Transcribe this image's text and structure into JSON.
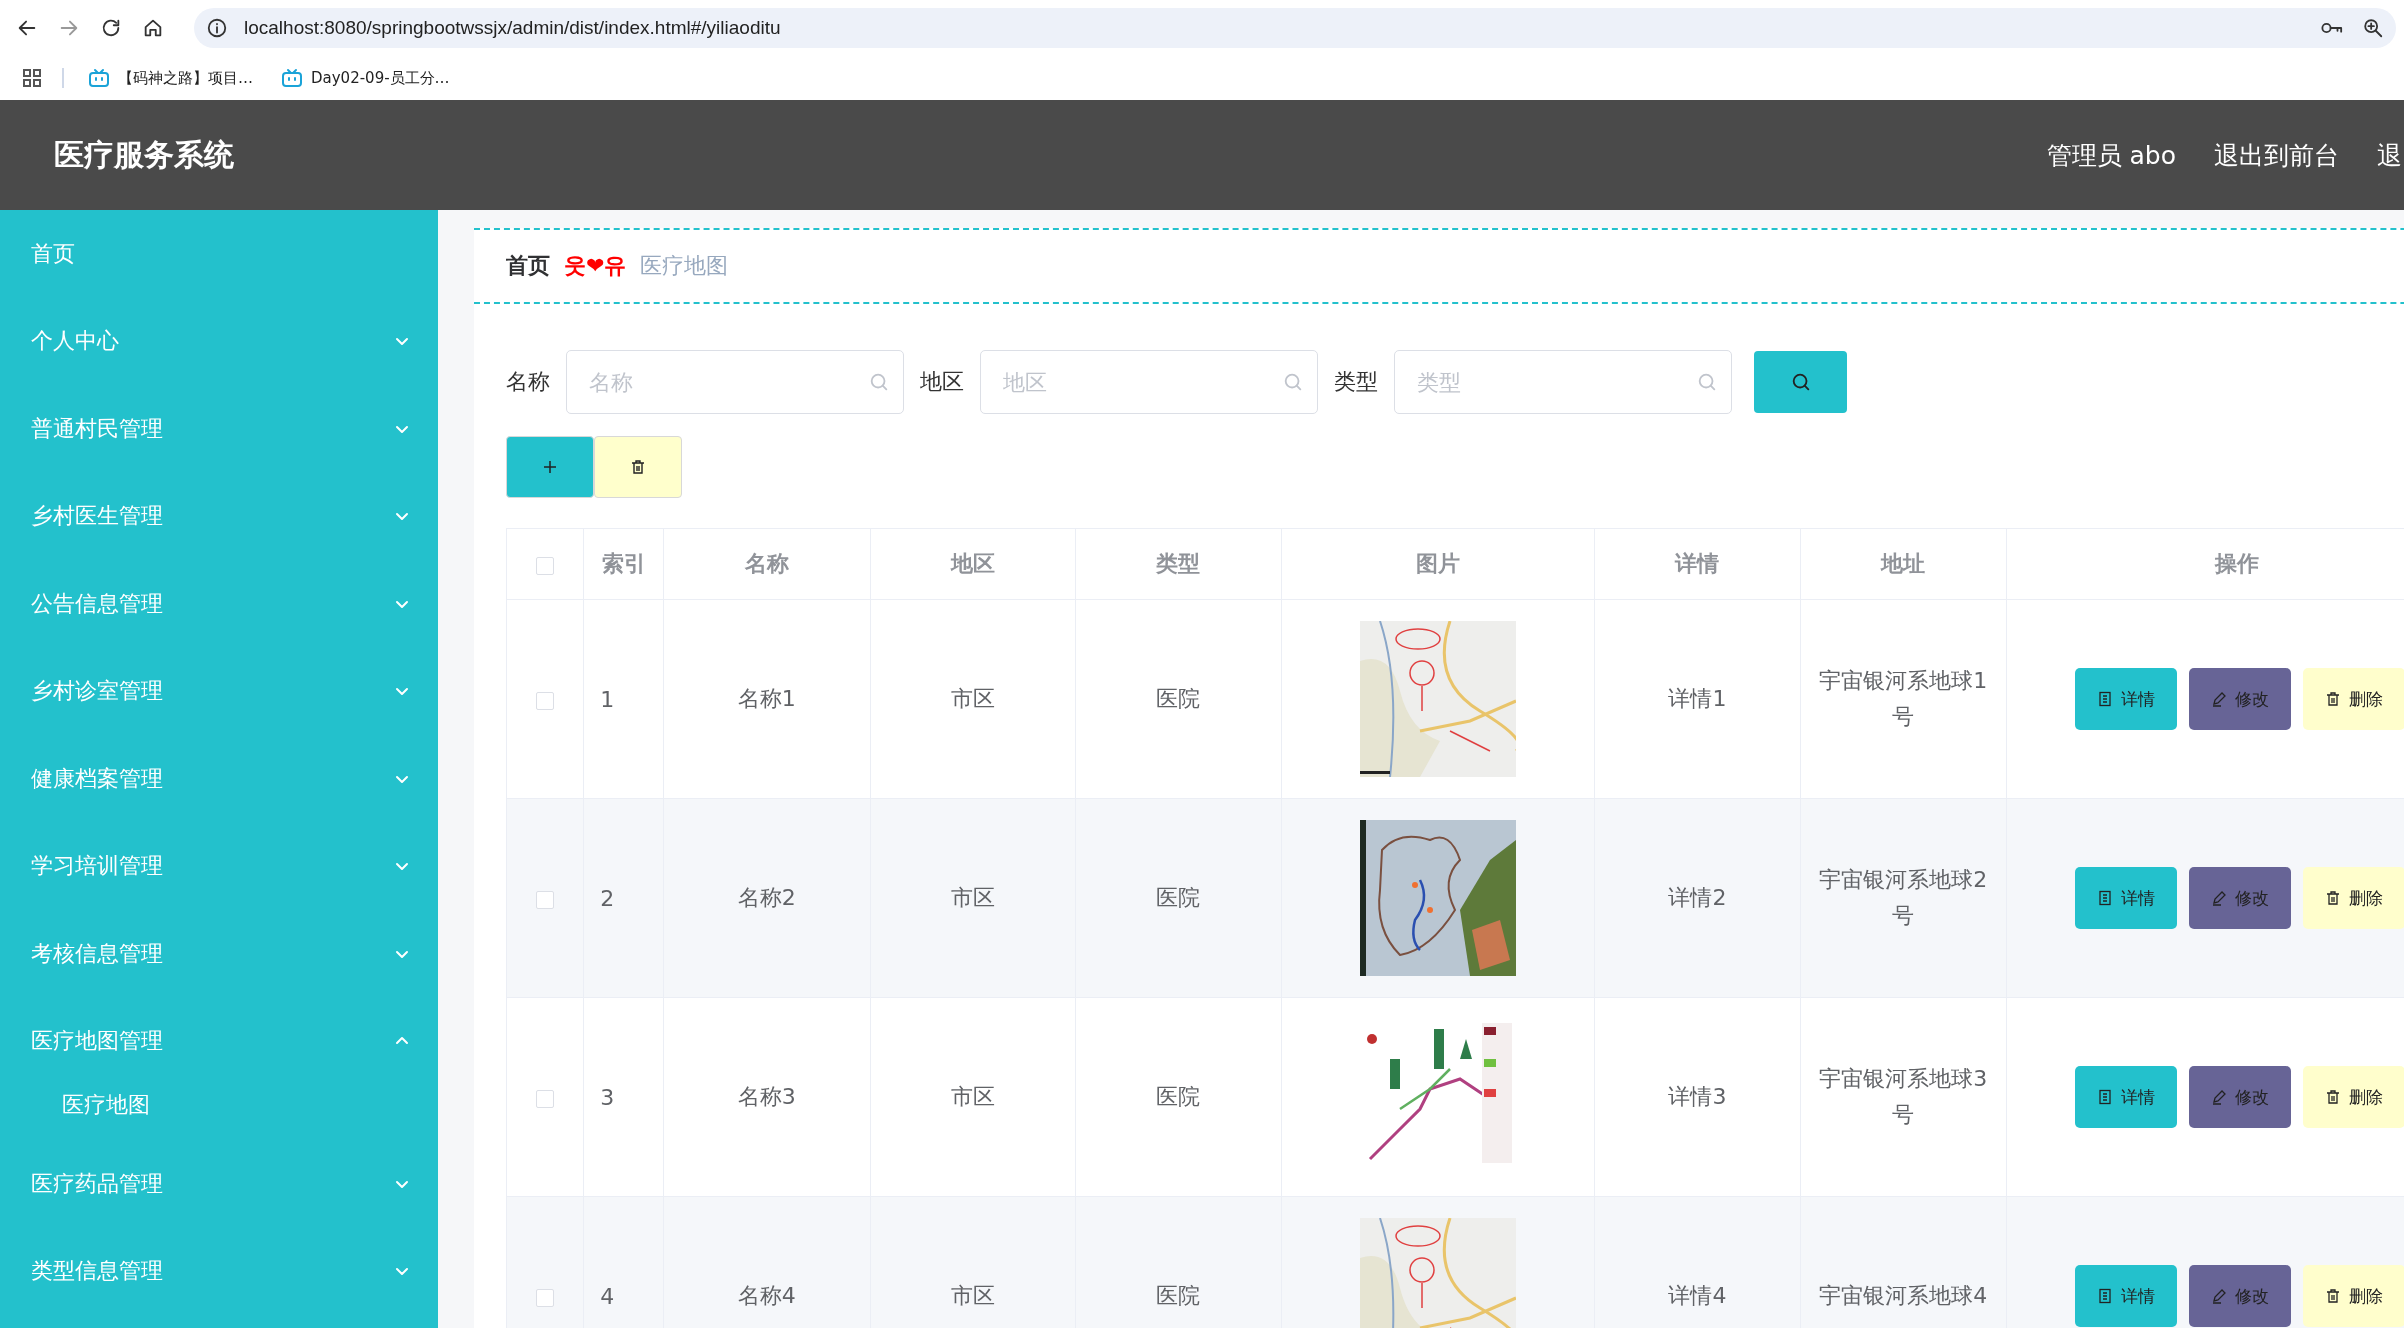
{
  "browser": {
    "url": "localhost:8080/springbootwssjx/admin/dist/index.html#/yiliaoditu",
    "bookmarks": [
      {
        "label": "【码神之路】项目…"
      },
      {
        "label": "Day02-09-员工分…"
      }
    ]
  },
  "header": {
    "title": "医疗服务系统",
    "links": [
      "管理员 abo",
      "退出到前台",
      "退"
    ]
  },
  "sidebar": {
    "items": [
      {
        "label": "首页",
        "kind": "link"
      },
      {
        "label": "个人中心",
        "kind": "menu",
        "expanded": false
      },
      {
        "label": "普通村民管理",
        "kind": "menu",
        "expanded": false
      },
      {
        "label": "乡村医生管理",
        "kind": "menu",
        "expanded": false
      },
      {
        "label": "公告信息管理",
        "kind": "menu",
        "expanded": false
      },
      {
        "label": "乡村诊室管理",
        "kind": "menu",
        "expanded": false
      },
      {
        "label": "健康档案管理",
        "kind": "menu",
        "expanded": false
      },
      {
        "label": "学习培训管理",
        "kind": "menu",
        "expanded": false
      },
      {
        "label": "考核信息管理",
        "kind": "menu",
        "expanded": false
      },
      {
        "label": "医疗地图管理",
        "kind": "menu",
        "expanded": true,
        "children": [
          {
            "label": "医疗地图"
          }
        ]
      },
      {
        "label": "医疗药品管理",
        "kind": "menu",
        "expanded": false
      },
      {
        "label": "类型信息管理",
        "kind": "menu",
        "expanded": false
      }
    ]
  },
  "breadcrumb": {
    "home": "首页",
    "separator": "웃❤유",
    "current": "医疗地图"
  },
  "search": {
    "fields": [
      {
        "label": "名称",
        "placeholder": "名称"
      },
      {
        "label": "地区",
        "placeholder": "地区"
      },
      {
        "label": "类型",
        "placeholder": "类型"
      }
    ]
  },
  "table": {
    "select_all": {
      "checked": false
    },
    "columns": [
      "索引",
      "名称",
      "地区",
      "类型",
      "图片",
      "详情",
      "地址",
      "操作"
    ],
    "rows": [
      {
        "checked": false,
        "index": "1",
        "name": "名称1",
        "region": "市区",
        "type": "医院",
        "image": {
          "kind": "picture"
        },
        "detail": "详情1",
        "address": "宇宙银河系地球1号",
        "actions": [
          {
            "kind": "detail",
            "label": "详情"
          },
          {
            "kind": "edit",
            "label": "修改"
          },
          {
            "kind": "delete",
            "label": "删除"
          }
        ]
      },
      {
        "checked": false,
        "index": "2",
        "name": "名称2",
        "region": "市区",
        "type": "医院",
        "image": {
          "kind": "picture"
        },
        "detail": "详情2",
        "address": "宇宙银河系地球2号",
        "actions": [
          {
            "kind": "detail",
            "label": "详情"
          },
          {
            "kind": "edit",
            "label": "修改"
          },
          {
            "kind": "delete",
            "label": "删除"
          }
        ]
      },
      {
        "checked": false,
        "index": "3",
        "name": "名称3",
        "region": "市区",
        "type": "医院",
        "image": {
          "kind": "picture"
        },
        "detail": "详情3",
        "address": "宇宙银河系地球3号",
        "actions": [
          {
            "kind": "detail",
            "label": "详情"
          },
          {
            "kind": "edit",
            "label": "修改"
          },
          {
            "kind": "delete",
            "label": "删除"
          }
        ]
      },
      {
        "checked": false,
        "index": "4",
        "name": "名称4",
        "region": "市区",
        "type": "医院",
        "image": {
          "kind": "picture"
        },
        "detail": "详情4",
        "address": "宇宙银河系地球4",
        "actions": [
          {
            "kind": "detail",
            "label": "详情"
          },
          {
            "kind": "edit",
            "label": "修改"
          },
          {
            "kind": "delete",
            "label": "删除"
          }
        ]
      }
    ]
  }
}
